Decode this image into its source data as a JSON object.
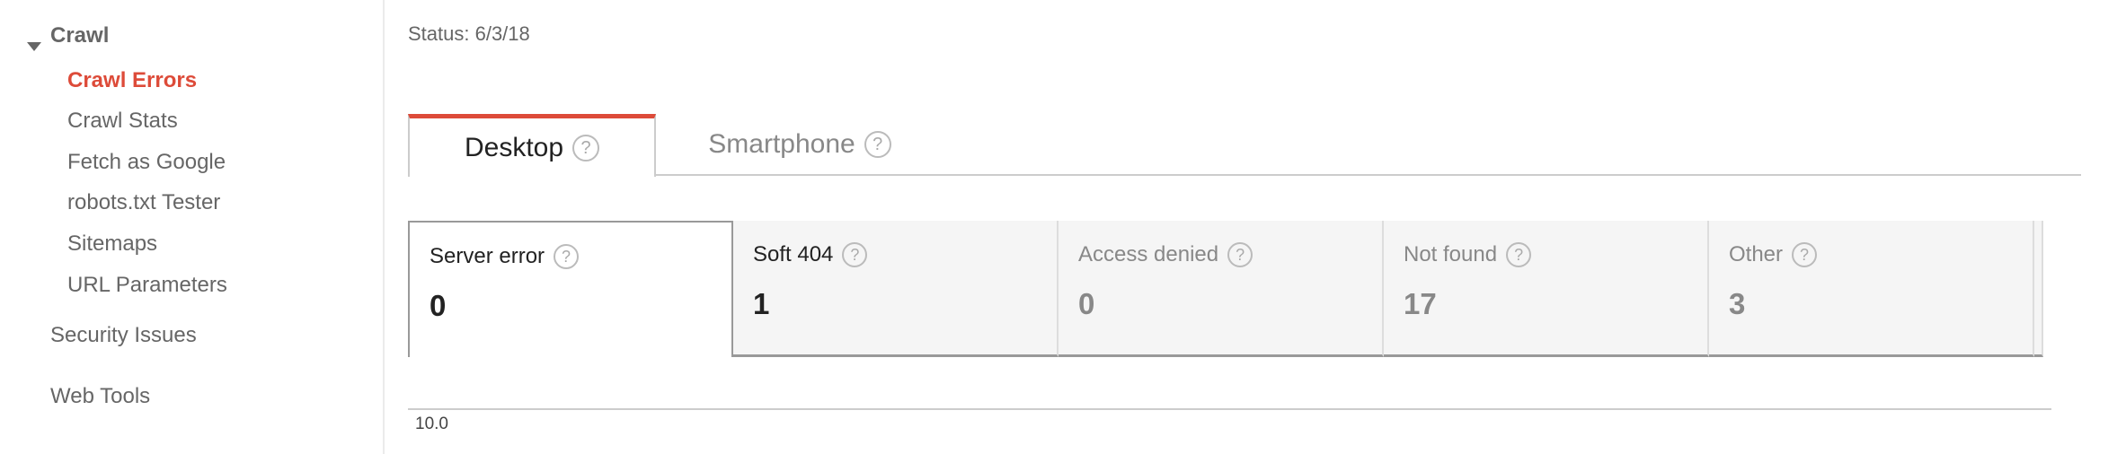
{
  "sidebar": {
    "section": "Crawl",
    "items": [
      {
        "label": "Crawl Errors",
        "active": true
      },
      {
        "label": "Crawl Stats"
      },
      {
        "label": "Fetch as Google"
      },
      {
        "label": "robots.txt Tester"
      },
      {
        "label": "Sitemaps"
      },
      {
        "label": "URL Parameters"
      }
    ],
    "other": [
      "Security Issues",
      "Web Tools"
    ]
  },
  "main": {
    "status": "Status: 6/3/18",
    "tabs": [
      {
        "label": "Desktop",
        "active": true
      },
      {
        "label": "Smartphone"
      }
    ],
    "help_icon": "?",
    "cards": [
      {
        "label": "Server error",
        "value": "0"
      },
      {
        "label": "Soft 404",
        "value": "1"
      },
      {
        "label": "Access denied",
        "value": "0"
      },
      {
        "label": "Not found",
        "value": "17"
      },
      {
        "label": "Other",
        "value": "3"
      }
    ],
    "chart_y_tick": "10.0"
  },
  "colors": {
    "accent": "#dd4b39",
    "card_bg": "#f5f5f5"
  }
}
